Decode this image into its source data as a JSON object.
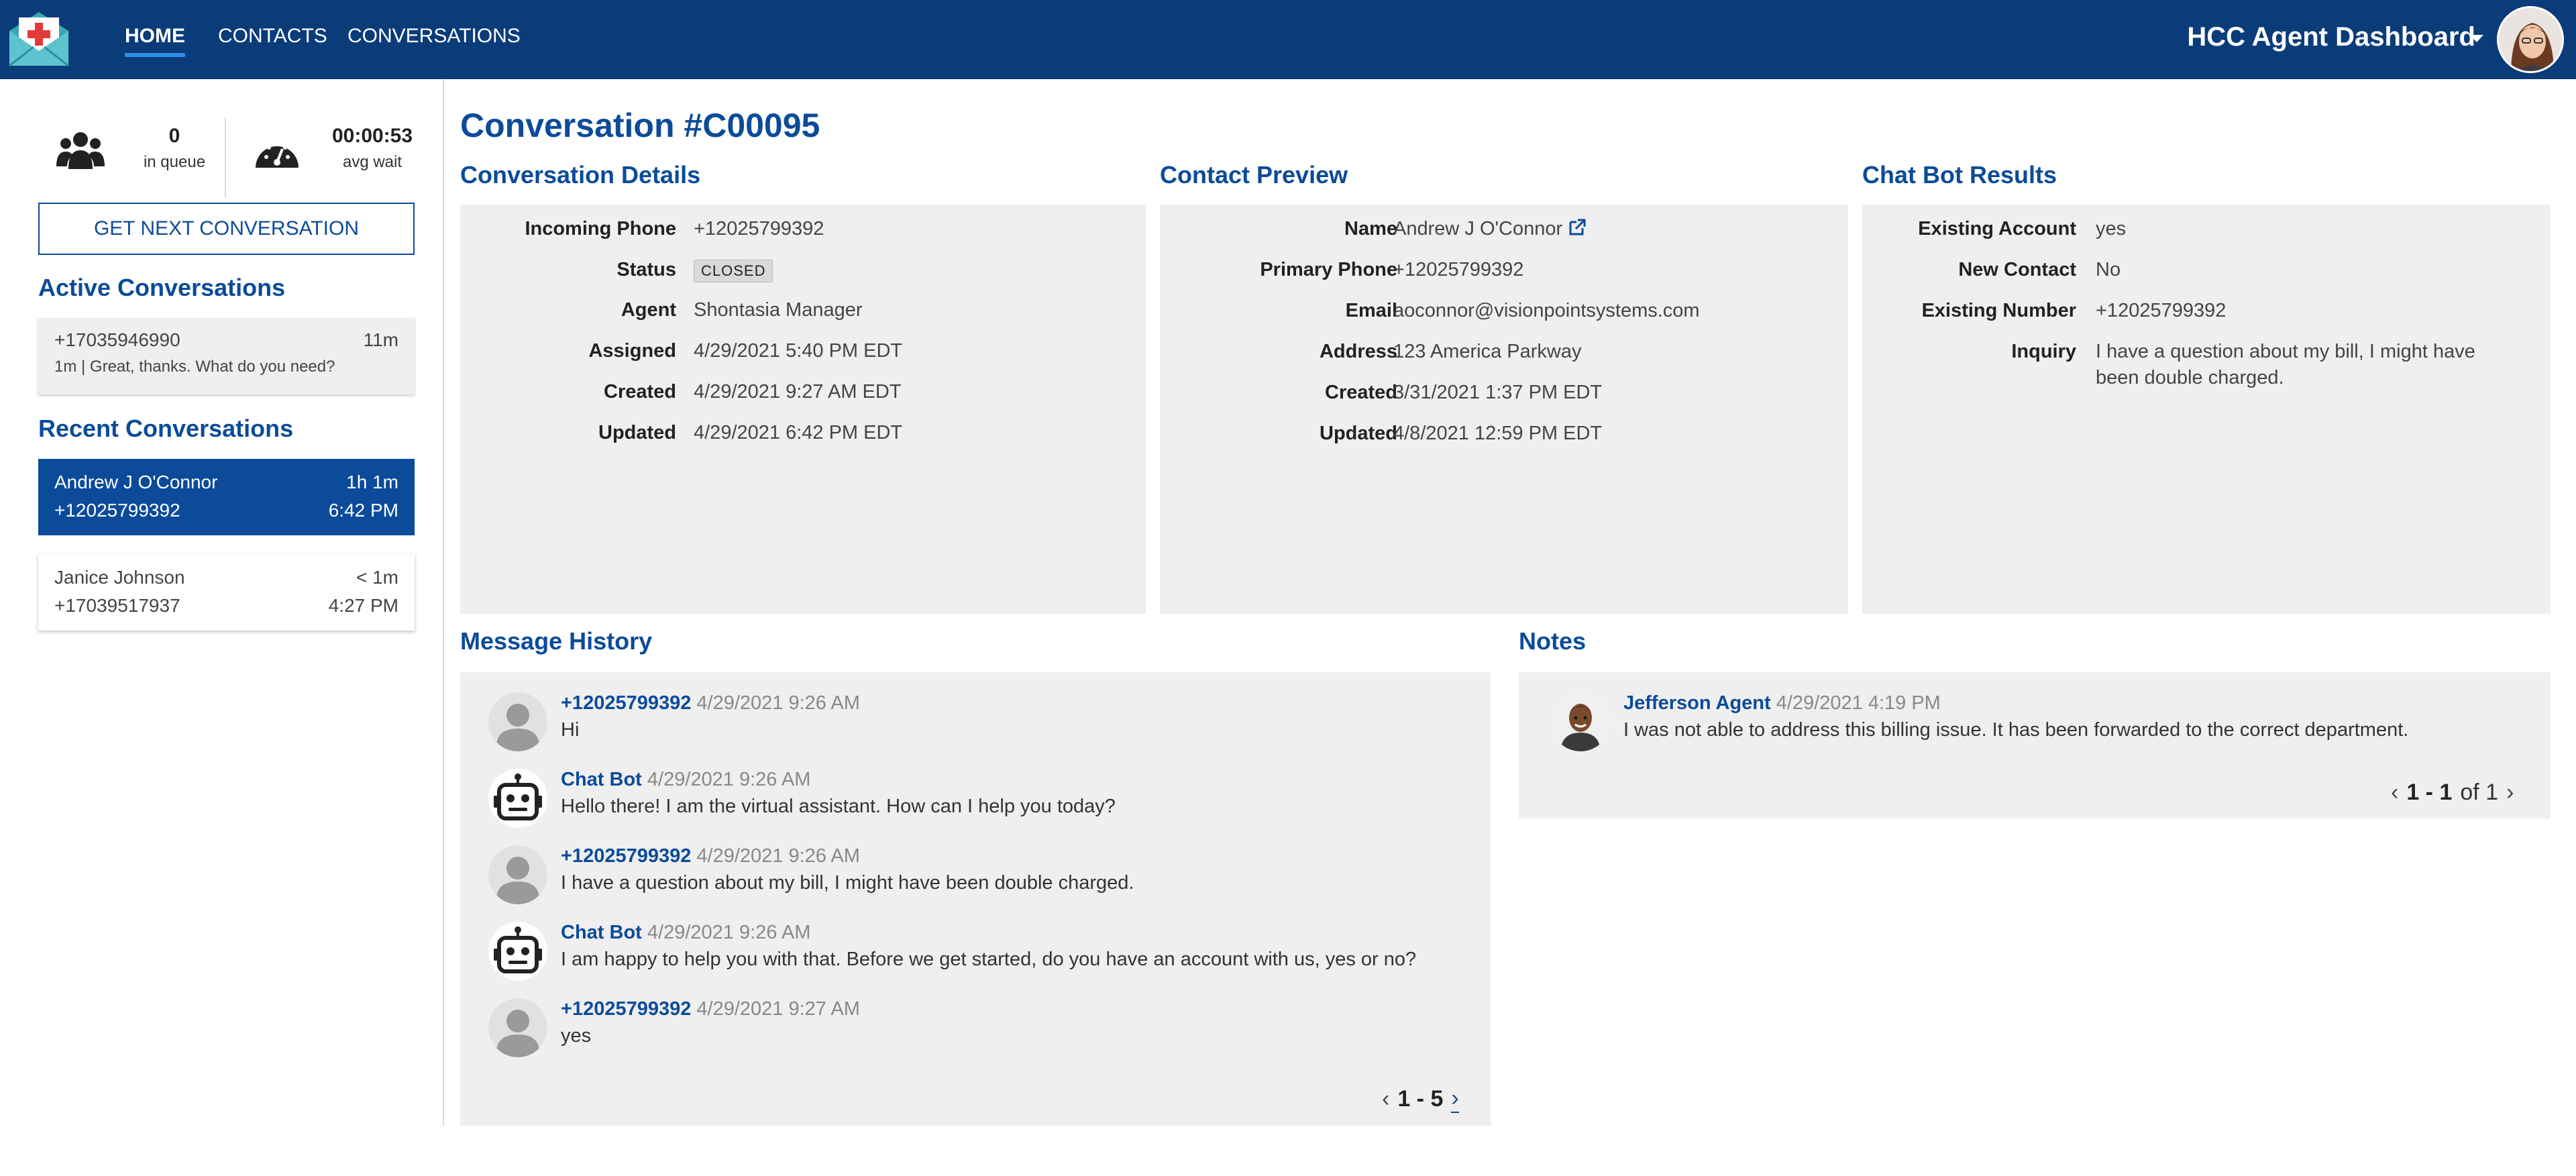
{
  "nav": {
    "items": [
      {
        "label": "HOME",
        "active": true
      },
      {
        "label": "CONTACTS",
        "active": false
      },
      {
        "label": "CONVERSATIONS",
        "active": false
      }
    ],
    "brand": "HCC Agent Dashboard"
  },
  "sidebar": {
    "queue": {
      "value": "0",
      "label": "in queue"
    },
    "wait": {
      "value": "00:00:53",
      "label": "avg wait"
    },
    "next_button": "GET NEXT CONVERSATION",
    "active_title": "Active Conversations",
    "active": [
      {
        "phone": "+17035946990",
        "age": "11m",
        "snippet": "1m | Great, thanks. What do you need?"
      }
    ],
    "recent_title": "Recent Conversations",
    "recent": [
      {
        "name": "Andrew J O'Connor",
        "duration": "1h 1m",
        "phone": "+12025799392",
        "time": "6:42 PM",
        "selected": true
      },
      {
        "name": "Janice Johnson",
        "duration": "< 1m",
        "phone": "+17039517937",
        "time": "4:27 PM",
        "selected": false
      }
    ]
  },
  "main": {
    "title": "Conversation #C00095",
    "details": {
      "title": "Conversation Details",
      "rows": [
        {
          "k": "Incoming Phone",
          "v": "+12025799392"
        },
        {
          "k": "Status",
          "v": "CLOSED"
        },
        {
          "k": "Agent",
          "v": "Shontasia Manager"
        },
        {
          "k": "Assigned",
          "v": "4/29/2021 5:40 PM EDT"
        },
        {
          "k": "Created",
          "v": "4/29/2021 9:27 AM EDT"
        },
        {
          "k": "Updated",
          "v": "4/29/2021 6:42 PM EDT"
        }
      ]
    },
    "contact": {
      "title": "Contact Preview",
      "rows": [
        {
          "k": "Name",
          "v": "Andrew J O'Connor"
        },
        {
          "k": "Primary Phone",
          "v": "+12025799392"
        },
        {
          "k": "Email",
          "v": "aoconnor@visionpointsystems.com"
        },
        {
          "k": "Address",
          "v": "123 America Parkway"
        },
        {
          "k": "Created",
          "v": "3/31/2021 1:37 PM EDT"
        },
        {
          "k": "Updated",
          "v": "4/8/2021 12:59 PM EDT"
        }
      ]
    },
    "bot": {
      "title": "Chat Bot Results",
      "rows": [
        {
          "k": "Existing Account",
          "v": "yes"
        },
        {
          "k": "New Contact",
          "v": "No"
        },
        {
          "k": "Existing Number",
          "v": "+12025799392"
        },
        {
          "k": "Inquiry",
          "v": "I have a question about my bill, I might have",
          "v2": "been double charged."
        }
      ]
    },
    "history": {
      "title": "Message History",
      "messages": [
        {
          "who": "+12025799392",
          "when": "4/29/2021 9:26 AM",
          "text": "Hi",
          "kind": "person"
        },
        {
          "who": "Chat Bot",
          "when": "4/29/2021 9:26 AM",
          "text": "Hello there! I am the virtual assistant. How can I help you today?",
          "kind": "bot"
        },
        {
          "who": "+12025799392",
          "when": "4/29/2021 9:26 AM",
          "text": "I have a question about my bill, I might have been double charged.",
          "kind": "person"
        },
        {
          "who": "Chat Bot",
          "when": "4/29/2021 9:26 AM",
          "text": "I am happy to help you with that. Before we get started, do you have an account with us, yes or no?",
          "kind": "bot"
        },
        {
          "who": "+12025799392",
          "when": "4/29/2021 9:27 AM",
          "text": "yes",
          "kind": "person"
        }
      ],
      "pager": "1 - 5"
    },
    "notes": {
      "title": "Notes",
      "items": [
        {
          "who": "Jefferson Agent",
          "when": "4/29/2021 4:19 PM",
          "text": "I was not able to address this billing issue. It has been forwarded to the correct department."
        }
      ],
      "pager_range": "1 - 1",
      "pager_of": "of 1"
    }
  }
}
